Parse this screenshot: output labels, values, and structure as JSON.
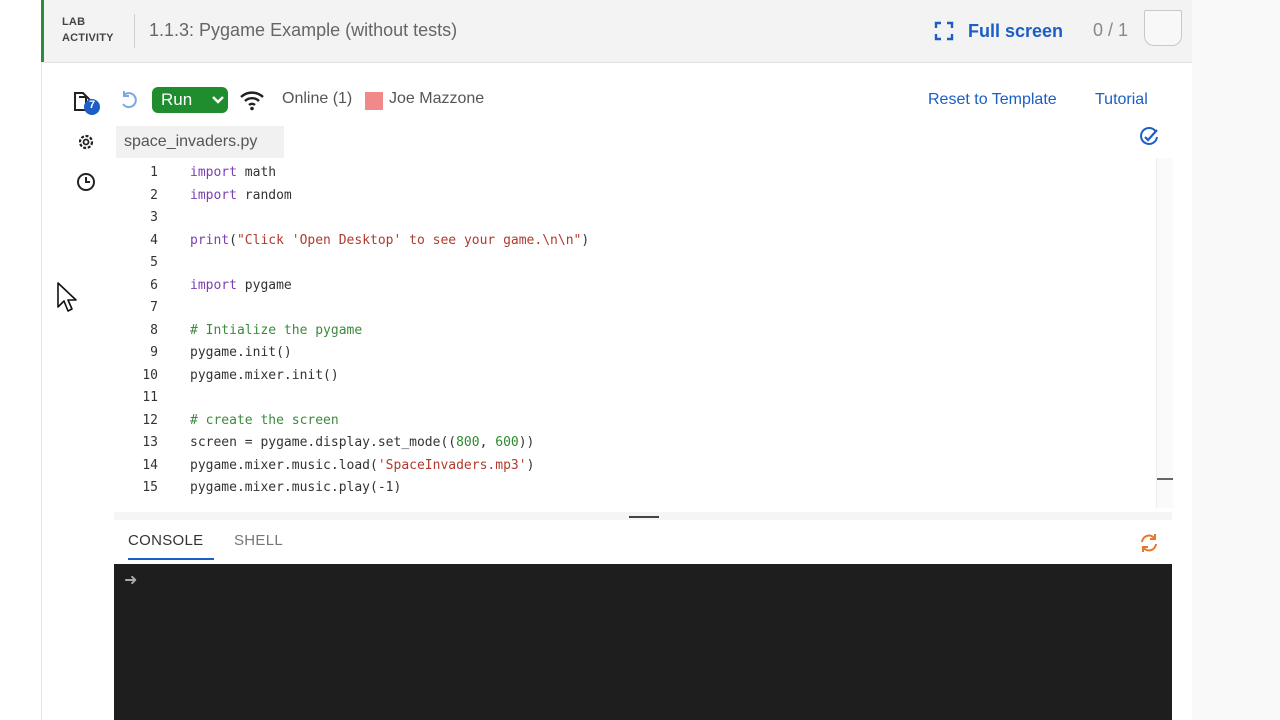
{
  "header": {
    "tag_line1": "LAB",
    "tag_line2": "ACTIVITY",
    "title": "1.1.3: Pygame Example (without tests)",
    "fullscreen_label": "Full screen",
    "score": "0 / 1"
  },
  "sidebar": {
    "files_badge": "7"
  },
  "toolbar": {
    "run_label": "Run",
    "online_status": "Online (1)",
    "user_name": "Joe Mazzone",
    "reset_label": "Reset to Template",
    "tutorial_label": "Tutorial"
  },
  "editor": {
    "filename": "space_invaders.py",
    "lines": [
      {
        "n": "1",
        "parts": [
          {
            "t": "import",
            "c": "kw"
          },
          {
            "t": " math",
            "c": ""
          }
        ]
      },
      {
        "n": "2",
        "parts": [
          {
            "t": "import",
            "c": "kw"
          },
          {
            "t": " random",
            "c": ""
          }
        ]
      },
      {
        "n": "3",
        "parts": []
      },
      {
        "n": "4",
        "parts": [
          {
            "t": "print",
            "c": "kw"
          },
          {
            "t": "(",
            "c": ""
          },
          {
            "t": "\"Click 'Open Desktop' to see your game.\\n\\n\"",
            "c": "str"
          },
          {
            "t": ")",
            "c": ""
          }
        ]
      },
      {
        "n": "5",
        "parts": []
      },
      {
        "n": "6",
        "parts": [
          {
            "t": "import",
            "c": "kw"
          },
          {
            "t": " pygame",
            "c": ""
          }
        ]
      },
      {
        "n": "7",
        "parts": []
      },
      {
        "n": "8",
        "parts": [
          {
            "t": "# Intialize the pygame",
            "c": "cmt"
          }
        ]
      },
      {
        "n": "9",
        "parts": [
          {
            "t": "pygame.init()",
            "c": ""
          }
        ]
      },
      {
        "n": "10",
        "parts": [
          {
            "t": "pygame.mixer.init()",
            "c": ""
          }
        ]
      },
      {
        "n": "11",
        "parts": []
      },
      {
        "n": "12",
        "parts": [
          {
            "t": "# create the screen",
            "c": "cmt"
          }
        ]
      },
      {
        "n": "13",
        "parts": [
          {
            "t": "screen = pygame.display.set_mode((",
            "c": ""
          },
          {
            "t": "800",
            "c": "num"
          },
          {
            "t": ", ",
            "c": ""
          },
          {
            "t": "600",
            "c": "num"
          },
          {
            "t": "))",
            "c": ""
          }
        ]
      },
      {
        "n": "14",
        "parts": [
          {
            "t": "pygame.mixer.music.load(",
            "c": ""
          },
          {
            "t": "'SpaceInvaders.mp3'",
            "c": "str"
          },
          {
            "t": ")",
            "c": ""
          }
        ]
      },
      {
        "n": "15",
        "parts": [
          {
            "t": "pygame.mixer.music.play(-1)",
            "c": ""
          }
        ]
      }
    ]
  },
  "console": {
    "tab_console": "CONSOLE",
    "tab_shell": "SHELL",
    "prompt": "➜"
  },
  "colors": {
    "accent_blue": "#1b5ec5",
    "run_green": "#1f8c2e",
    "lab_green": "#2e8b3d",
    "refresh_orange": "#e8772e"
  }
}
